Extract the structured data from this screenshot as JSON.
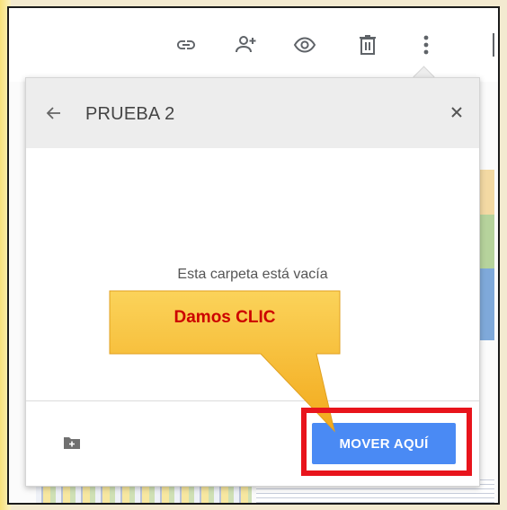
{
  "toolbar": {
    "icons": [
      "link-icon",
      "add-person-icon",
      "preview-eye-icon",
      "trash-icon",
      "more-vert-icon"
    ]
  },
  "dialog": {
    "title": "PRUEBA 2",
    "empty_message": "Esta carpeta está vacía",
    "move_button_label": "MOVER AQUÍ"
  },
  "annotation": {
    "callout_text": "Damos CLIC",
    "highlight_color": "#e8141c",
    "callout_color": "#f7bd2f"
  },
  "colors": {
    "accent_button": "#4a8af4",
    "dialog_header": "#ededed"
  }
}
